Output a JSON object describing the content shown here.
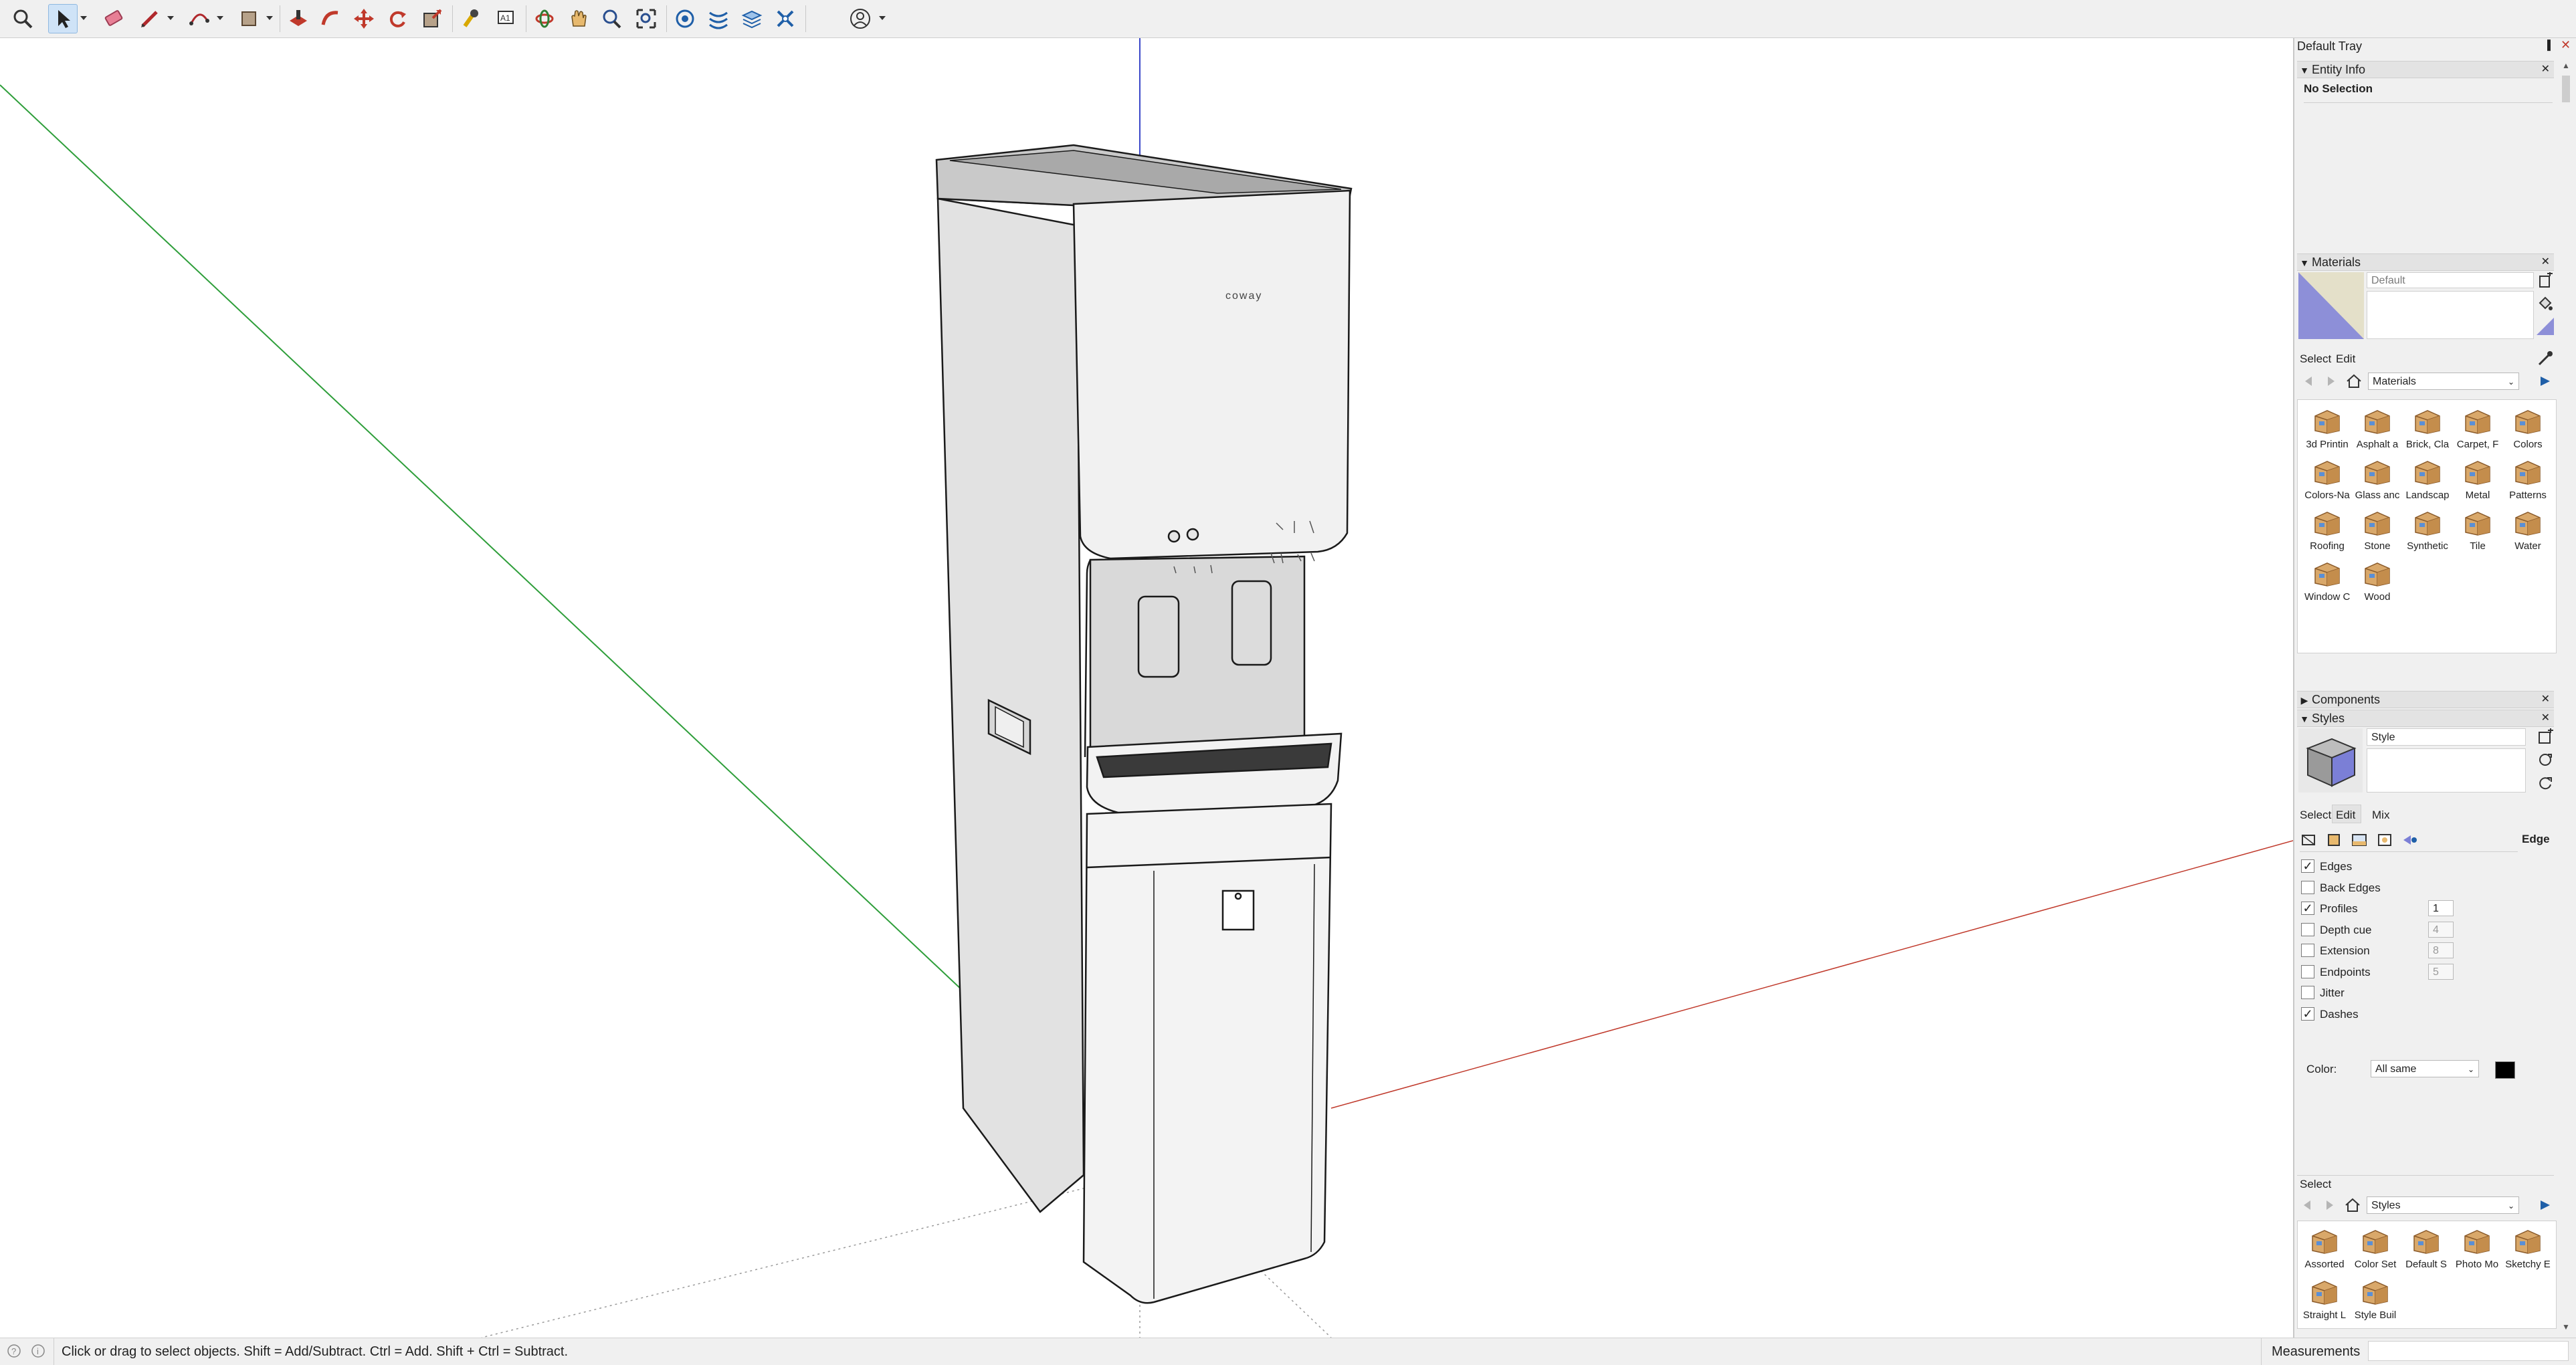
{
  "toolbar": {
    "tools": [
      "search-icon",
      "select-icon",
      "eraser-icon",
      "pencil-icon",
      "arc-icon",
      "shape-icon",
      "push-pull-icon",
      "follow-me-icon",
      "move-icon",
      "rotate-icon",
      "scale-icon",
      "tape-measure-icon",
      "text-icon",
      "orbit-icon",
      "pan-icon",
      "zoom-icon",
      "zoom-extents-icon",
      "warehouse-icon",
      "sections-icon",
      "layers-icon",
      "extension-icon",
      "account-icon"
    ]
  },
  "tray": {
    "title": "Default Tray",
    "entity_info": {
      "header": "Entity Info",
      "status": "No Selection"
    },
    "materials": {
      "header": "Materials",
      "current_name": "Default",
      "tabs": [
        "Select",
        "Edit"
      ],
      "collection": "Materials",
      "items": [
        "3d Printin",
        "Asphalt a",
        "Brick, Cla",
        "Carpet, F",
        "Colors",
        "Colors-Na",
        "Glass anc",
        "Landscap",
        "Metal",
        "Patterns",
        "Roofing",
        "Stone",
        "Synthetic",
        "Tile",
        "Water",
        "Window C",
        "Wood"
      ]
    },
    "components": {
      "header": "Components"
    },
    "styles": {
      "header": "Styles",
      "name": "Style",
      "tabs": [
        "Select",
        "Edit",
        "Mix"
      ],
      "section_title": "Edge",
      "edge_settings": [
        {
          "label": "Edges",
          "checked": true,
          "value": ""
        },
        {
          "label": "Back Edges",
          "checked": false,
          "value": ""
        },
        {
          "label": "Profiles",
          "checked": true,
          "value": "1"
        },
        {
          "label": "Depth cue",
          "checked": false,
          "value": "4"
        },
        {
          "label": "Extension",
          "checked": false,
          "value": "8"
        },
        {
          "label": "Endpoints",
          "checked": false,
          "value": "5"
        },
        {
          "label": "Jitter",
          "checked": false,
          "value": ""
        },
        {
          "label": "Dashes",
          "checked": true,
          "value": ""
        }
      ],
      "color_label": "Color:",
      "color_value": "All same",
      "select_label": "Select",
      "collection": "Styles",
      "items": [
        "Assorted",
        "Color Set",
        "Default S",
        "Photo Mo",
        "Sketchy E",
        "Straight L",
        "Style Buil"
      ]
    }
  },
  "model": {
    "brand": "coway"
  },
  "status": {
    "hint": "Click or drag to select objects. Shift = Add/Subtract. Ctrl = Add. Shift + Ctrl = Subtract.",
    "measurements_label": "Measurements"
  },
  "colors": {
    "accent": "#3a78c2",
    "axis_red": "#c0392b",
    "axis_green": "#2e9e3a",
    "axis_blue": "#3b48c9"
  }
}
